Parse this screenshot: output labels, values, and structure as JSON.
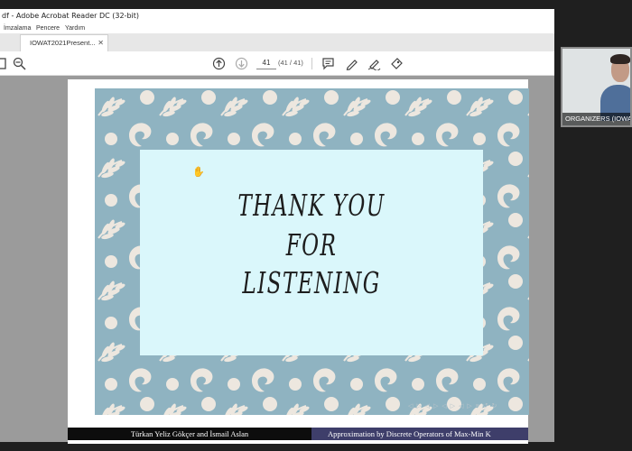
{
  "window": {
    "title": "df - Adobe Acrobat Reader DC (32-bit)"
  },
  "menu": {
    "items": [
      "İmzalama",
      "Pencere",
      "Yardım"
    ]
  },
  "tab": {
    "label": "IOWAT2021Present...",
    "close": "✕"
  },
  "toolbar": {
    "page_current": "41",
    "page_total": "(41 / 41)"
  },
  "slide": {
    "lines": [
      "THANK YOU",
      "FOR",
      "LISTENING"
    ],
    "nav_symbols": "◁ ▷ ◁ ▷ ◁ ▷ ◁ ▷ ≡ ↺ ↻",
    "footer_left": "Türkan Yeliz Gökçer and İsmail Aslan",
    "footer_right": "Approximation by Discrete Operators of Max-Min K"
  },
  "video": {
    "label": "ORGANIZERS (IOWA"
  },
  "colors": {
    "slide_bg": "#8fb3c1",
    "card_bg": "#daf7fb",
    "footer_right": "#3e3e6a"
  }
}
